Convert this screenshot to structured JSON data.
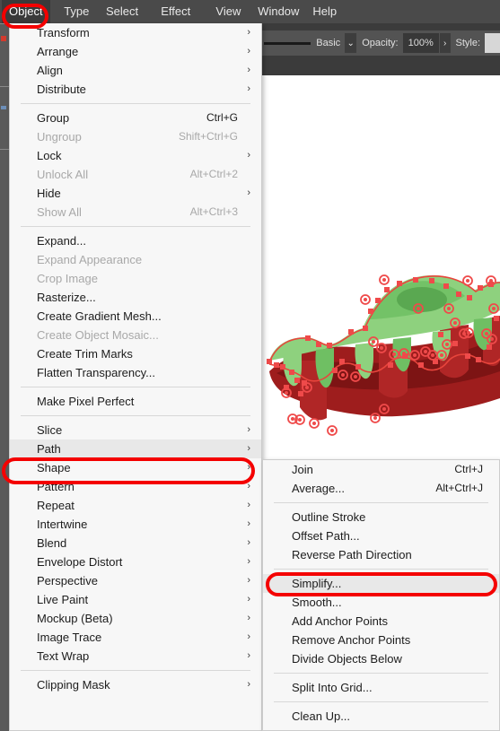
{
  "app": {
    "menubar": [
      {
        "label": "Object",
        "active": true
      },
      {
        "label": "Type",
        "active": false
      },
      {
        "label": "Select",
        "active": false
      },
      {
        "label": "Effect",
        "active": false
      },
      {
        "label": "View",
        "active": false
      },
      {
        "label": "Window",
        "active": false
      },
      {
        "label": "Help",
        "active": false
      }
    ]
  },
  "options_bar": {
    "stroke_profile": "Basic",
    "stroke_caret": "⌄",
    "opacity_label": "Opacity:",
    "opacity_value": "100%",
    "opacity_arrow": "›",
    "style_label": "Style:"
  },
  "menu": {
    "groups": [
      {
        "items": [
          {
            "label": "Transform",
            "submenu": true
          },
          {
            "label": "Arrange",
            "submenu": true
          },
          {
            "label": "Align",
            "submenu": true
          },
          {
            "label": "Distribute",
            "submenu": true
          }
        ]
      },
      {
        "items": [
          {
            "label": "Group",
            "shortcut": "Ctrl+G"
          },
          {
            "label": "Ungroup",
            "shortcut": "Shift+Ctrl+G",
            "disabled": true
          },
          {
            "label": "Lock",
            "submenu": true
          },
          {
            "label": "Unlock All",
            "shortcut": "Alt+Ctrl+2",
            "disabled": true
          },
          {
            "label": "Hide",
            "submenu": true
          },
          {
            "label": "Show All",
            "shortcut": "Alt+Ctrl+3",
            "disabled": true
          }
        ]
      },
      {
        "items": [
          {
            "label": "Expand..."
          },
          {
            "label": "Expand Appearance",
            "disabled": true
          },
          {
            "label": "Crop Image",
            "disabled": true
          },
          {
            "label": "Rasterize..."
          },
          {
            "label": "Create Gradient Mesh..."
          },
          {
            "label": "Create Object Mosaic...",
            "disabled": true
          },
          {
            "label": "Create Trim Marks"
          },
          {
            "label": "Flatten Transparency..."
          }
        ]
      },
      {
        "items": [
          {
            "label": "Make Pixel Perfect"
          }
        ]
      },
      {
        "items": [
          {
            "label": "Slice",
            "submenu": true
          },
          {
            "label": "Path",
            "submenu": true,
            "highlighted": true
          },
          {
            "label": "Shape",
            "submenu": true
          },
          {
            "label": "Pattern",
            "submenu": true
          },
          {
            "label": "Repeat",
            "submenu": true
          },
          {
            "label": "Intertwine",
            "submenu": true
          },
          {
            "label": "Blend",
            "submenu": true
          },
          {
            "label": "Envelope Distort",
            "submenu": true
          },
          {
            "label": "Perspective",
            "submenu": true
          },
          {
            "label": "Live Paint",
            "submenu": true
          },
          {
            "label": "Mockup (Beta)",
            "submenu": true
          },
          {
            "label": "Image Trace",
            "submenu": true
          },
          {
            "label": "Text Wrap",
            "submenu": true
          }
        ]
      },
      {
        "items": [
          {
            "label": "Clipping Mask",
            "submenu": true
          }
        ]
      }
    ]
  },
  "submenu": {
    "groups": [
      {
        "items": [
          {
            "label": "Join",
            "shortcut": "Ctrl+J"
          },
          {
            "label": "Average...",
            "shortcut": "Alt+Ctrl+J"
          }
        ]
      },
      {
        "items": [
          {
            "label": "Outline Stroke"
          },
          {
            "label": "Offset Path..."
          },
          {
            "label": "Reverse Path Direction"
          }
        ]
      },
      {
        "items": [
          {
            "label": "Simplify...",
            "highlighted": true
          },
          {
            "label": "Smooth..."
          },
          {
            "label": "Add Anchor Points"
          },
          {
            "label": "Remove Anchor Points"
          },
          {
            "label": "Divide Objects Below"
          }
        ]
      },
      {
        "items": [
          {
            "label": "Split Into Grid..."
          }
        ]
      },
      {
        "items": [
          {
            "label": "Clean Up..."
          }
        ]
      }
    ]
  },
  "annotations": {
    "highlight_color": "#f40000",
    "targets": [
      "Object",
      "Path",
      "Simplify..."
    ]
  },
  "artwork": {
    "name": "vector-illustration-selected-path",
    "fill_green_light": "#8ed17e",
    "fill_green_mid": "#6fbf63",
    "fill_green_dark": "#5aa851",
    "fill_red_dark": "#9e1d1d",
    "fill_red_mid": "#b02626",
    "fill_red_deep": "#7d1414",
    "anchor_color": "#ef4a4a",
    "selection_stroke": "#e8453c"
  }
}
